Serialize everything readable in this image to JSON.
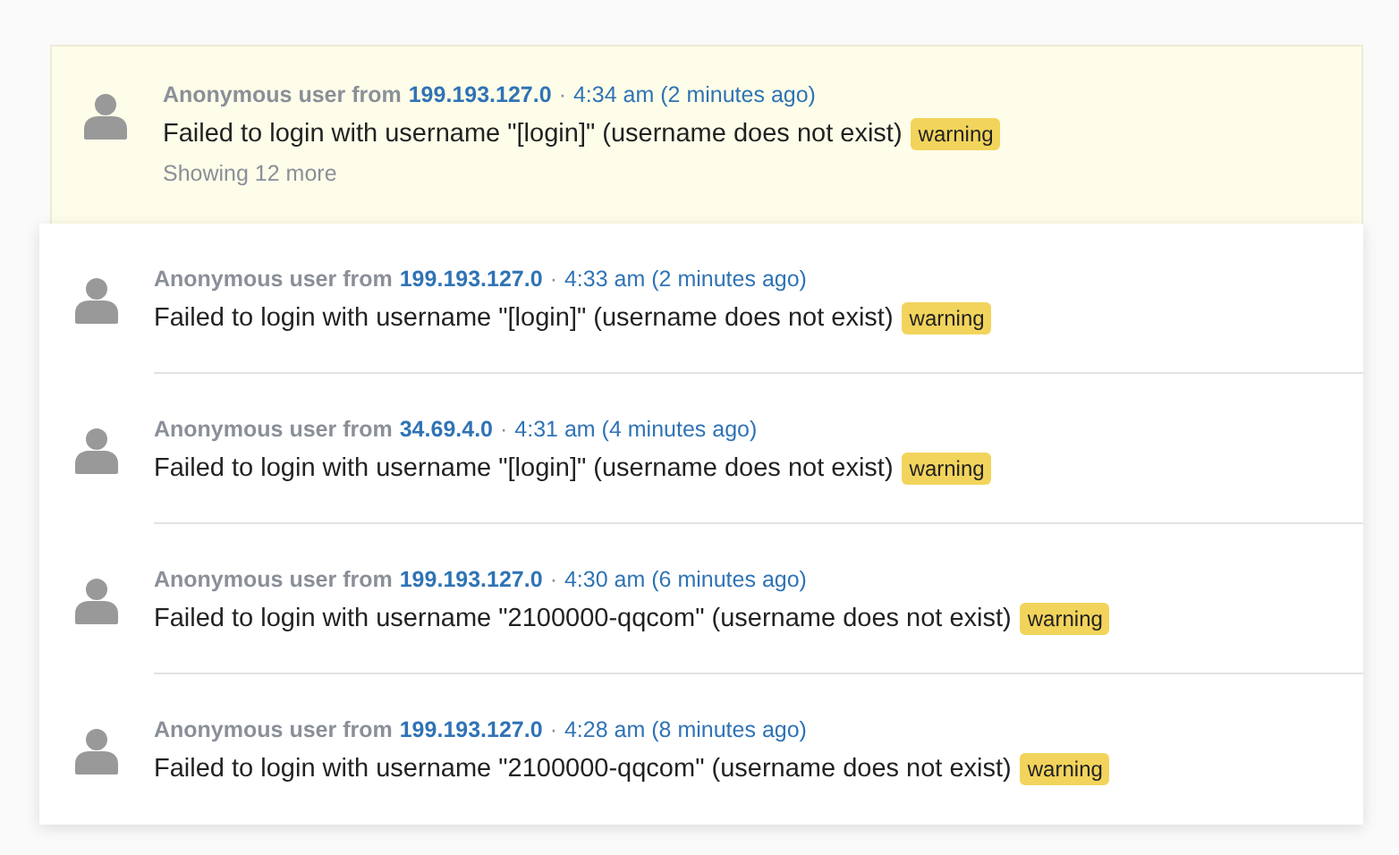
{
  "featured": {
    "user": "Anonymous user from",
    "ip": "199.193.127.0",
    "separator": "·",
    "time": "4:34 am (2 minutes ago)",
    "message": "Failed to login with username \"[login]\" (username does not exist)",
    "badge": "warning",
    "more": "Showing 12 more"
  },
  "events": [
    {
      "user": "Anonymous user from",
      "ip": "199.193.127.0",
      "separator": "·",
      "time": "4:33 am (2 minutes ago)",
      "message": "Failed to login with username \"[login]\" (username does not exist)",
      "badge": "warning"
    },
    {
      "user": "Anonymous user from",
      "ip": "34.69.4.0",
      "separator": "·",
      "time": "4:31 am (4 minutes ago)",
      "message": "Failed to login with username \"[login]\" (username does not exist)",
      "badge": "warning"
    },
    {
      "user": "Anonymous user from",
      "ip": "199.193.127.0",
      "separator": "·",
      "time": "4:30 am (6 minutes ago)",
      "message": "Failed to login with username \"2100000-qqcom\" (username does not exist)",
      "badge": "warning"
    },
    {
      "user": "Anonymous user from",
      "ip": "199.193.127.0",
      "separator": "·",
      "time": "4:28 am (8 minutes ago)",
      "message": "Failed to login with username \"2100000-qqcom\" (username does not exist)",
      "badge": "warning"
    }
  ]
}
